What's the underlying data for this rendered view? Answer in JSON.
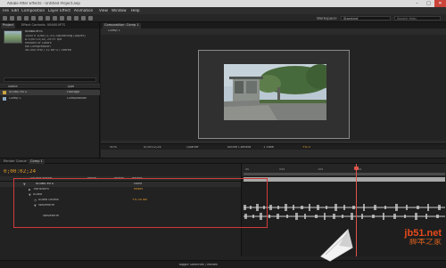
{
  "window": {
    "title": "Adobe After Effects - Untitled Project.aep"
  },
  "menu": [
    "File",
    "Edit",
    "Composition",
    "Layer",
    "Effect",
    "Animation",
    "View",
    "Window",
    "Help"
  ],
  "toolbar": {
    "workspace_label": "Workspace:",
    "workspace_value": "Standard",
    "search_placeholder": "Search Help"
  },
  "project": {
    "tabs": [
      "Project",
      "Effect Controls: 00460.MTS"
    ],
    "file_name": "00460.MTS",
    "info_lines": [
      "1440 x 1080 (1.33) Squashing (Upper)",
      "Δ 0;00:15;18, 29.97 fps",
      "Millions of Colors",
      "No Compression",
      "48.000 kHz / 32 bit U / Stereo"
    ],
    "col_name": "Name",
    "col_type": "Type",
    "items": [
      {
        "name": "00460.MTS",
        "type": "Footage",
        "color": "#c9a441"
      },
      {
        "name": "Comp 1",
        "type": "Composition",
        "color": "#8aa7c2"
      }
    ],
    "bpc": "8 bpc"
  },
  "composition": {
    "tab": "Composition: Comp 1",
    "sub_tab": "Comp 1",
    "zoom": "50%",
    "time": "0;00:02;24",
    "resolution": "Quarter",
    "camera": "Active Camera",
    "views": "1 View",
    "exposure": "+0.0"
  },
  "timeline": {
    "tabs": [
      "Render Queue",
      "Comp 1"
    ],
    "timecode": "0;00:02;24",
    "cols": {
      "source": "Source Name",
      "mode": "Mode",
      "trkmat": "TrkMat",
      "parent": "Parent"
    },
    "layer_name": "00460.MTS",
    "props": [
      "Transform",
      "Audio",
      "Audio Levels",
      "Waveform",
      "Waveform"
    ],
    "reset": "Reset",
    "levels_value": "+0.00 dB",
    "parent_value": "None",
    "ticks": [
      "0s",
      "05s",
      "10s",
      "15s"
    ],
    "footer": "Toggle Switches / Modes"
  },
  "watermark": {
    "line1": "jb51.net",
    "line2": "脚本之家"
  }
}
